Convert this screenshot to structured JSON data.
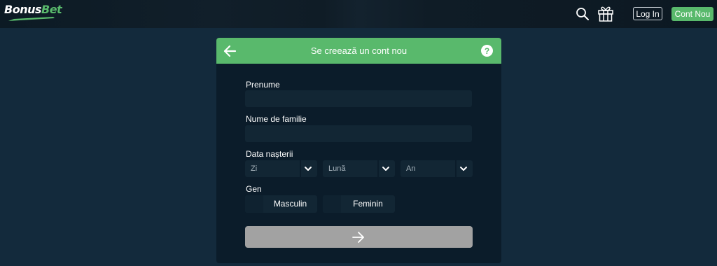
{
  "header": {
    "logo_part1": "Bonus",
    "logo_part2": "Bet",
    "login_label": "Log In",
    "signup_label": "Cont Nou",
    "icons": [
      "search-icon",
      "gift-icon"
    ]
  },
  "form": {
    "title": "Se creează un cont nou",
    "help_label": "?",
    "first_name_label": "Prenume",
    "first_name_value": "",
    "last_name_label": "Nume de familie",
    "last_name_value": "",
    "birthdate_label": "Data nașterii",
    "day_value": "Zi",
    "month_value": "Lună",
    "year_value": "An",
    "gender_label": "Gen",
    "gender_options": [
      "Masculin",
      "Feminin"
    ]
  },
  "colors": {
    "accent": "#59b96c",
    "background": "#132a3c",
    "panel": "#0b1c2a",
    "field": "#122634",
    "submit_disabled": "#a2a2a2"
  }
}
